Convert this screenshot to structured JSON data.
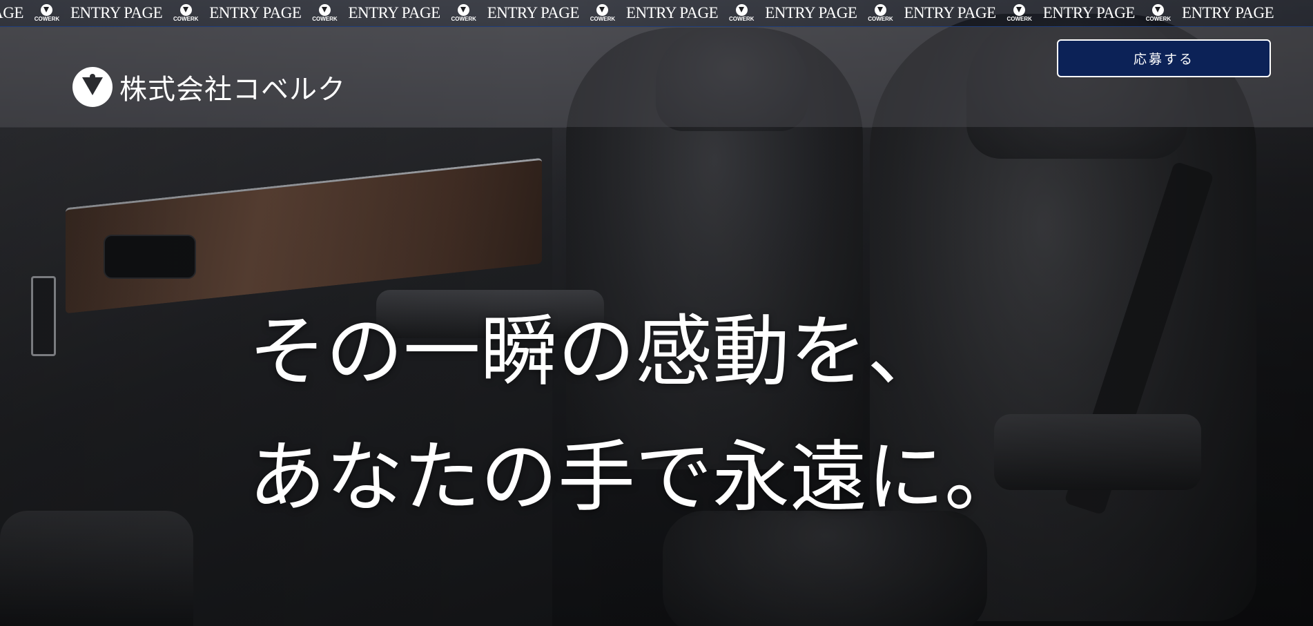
{
  "banner": {
    "leading_fragment": "PAGE",
    "items": [
      {
        "text": "ENTRY PAGE",
        "logo_caption": "COWERK"
      },
      {
        "text": "ENTRY PAGE",
        "logo_caption": "COWERK"
      },
      {
        "text": "ENTRY PAGE",
        "logo_caption": "COWERK"
      },
      {
        "text": "ENTRY PAGE",
        "logo_caption": "COWERK"
      },
      {
        "text": "ENTRY PAGE",
        "logo_caption": "COWERK"
      },
      {
        "text": "ENTRY PAGE",
        "logo_caption": "COWERK"
      },
      {
        "text": "ENTRY PAGE",
        "logo_caption": "COWERK"
      },
      {
        "text": "ENTRY PAGE",
        "logo_caption": "COWERK"
      },
      {
        "text": "ENTRY PAGE",
        "logo_caption": "COWERK"
      }
    ],
    "border_color": "#1f3d7a"
  },
  "header": {
    "company_name": "株式会社コベルク",
    "logo_icon": "cowerk-logo-icon",
    "apply_button_label": "応募する",
    "apply_button_color": "#0c2257"
  },
  "hero": {
    "line1": "その一瞬の感動を、",
    "line2": "あなたの手で永遠に。"
  }
}
